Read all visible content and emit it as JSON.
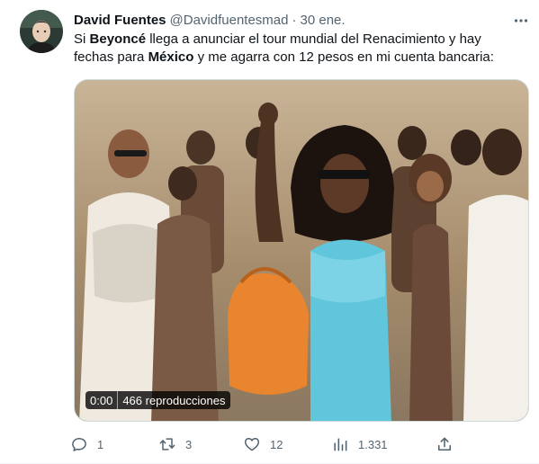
{
  "tweet": {
    "author_name": "David Fuentes",
    "handle": "@Davidfuentesmad",
    "separator": "·",
    "date": "30 ene.",
    "text_parts": [
      "Si ",
      "Beyoncé",
      " llega a anunciar el tour mundial del Renacimiento y hay fechas para ",
      "México",
      " y me agarra con 12 pesos en mi cuenta bancaria:"
    ]
  },
  "media": {
    "timestamp": "0:00",
    "views": "466 reproducciones"
  },
  "actions": {
    "replies": "1",
    "retweets": "3",
    "likes": "12",
    "views": "1.331"
  },
  "icons": {
    "more": "more-horizontal-icon",
    "reply": "reply-icon",
    "retweet": "retweet-icon",
    "like": "heart-icon",
    "views": "views-bar-chart-icon",
    "share": "share-upload-icon"
  },
  "colors": {
    "text_primary": "#0f1419",
    "text_secondary": "#536471",
    "border": "#cfd9de"
  }
}
